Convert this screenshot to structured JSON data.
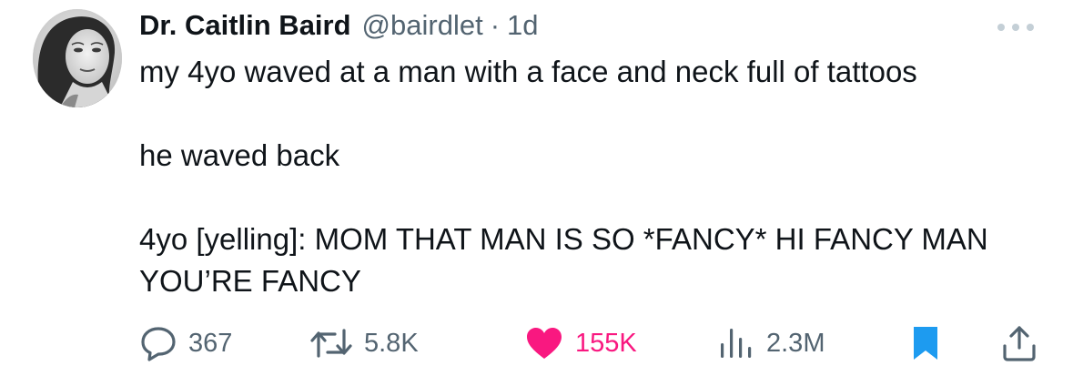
{
  "tweet": {
    "author": {
      "display_name": "Dr. Caitlin Baird",
      "handle": "@bairdlet",
      "separator": "·",
      "time": "1d"
    },
    "body": {
      "line1": "my 4yo waved at a man with a face and neck full of tattoos",
      "line2": "he waved back",
      "line3": "4yo [yelling]: MOM THAT MAN IS SO *FANCY* HI FANCY MAN YOU’RE FANCY"
    },
    "actions": {
      "replies": {
        "icon": "reply-icon",
        "count": "367"
      },
      "retweets": {
        "icon": "retweet-icon",
        "count": "5.8K"
      },
      "likes": {
        "icon": "heart-icon",
        "count": "155K",
        "liked": true
      },
      "views": {
        "icon": "views-icon",
        "count": "2.3M"
      },
      "bookmark": {
        "icon": "bookmark-icon",
        "bookmarked": true
      },
      "share": {
        "icon": "share-icon"
      }
    },
    "colors": {
      "text": "#0f1419",
      "secondary": "#536471",
      "like": "#f91880",
      "bookmark": "#1d9bf0"
    }
  }
}
